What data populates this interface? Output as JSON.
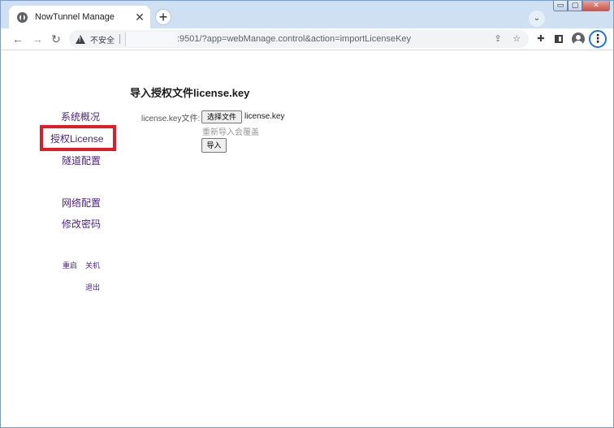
{
  "browser": {
    "tab_title": "NowTunnel Manage",
    "tab_close": "✕",
    "new_tab": "+",
    "tab_search": "⌄",
    "window_controls": {
      "minimize": "▭",
      "maximize": "▢",
      "close": "✕"
    },
    "back": "←",
    "forward": "→",
    "reload": "↻",
    "insecure_label": "不安全",
    "url_visible": ":9501/?app=webManage.control&action=importLicenseKey",
    "share_icon": "⇪",
    "bookmark_icon": "☆",
    "extensions_icon": "✚",
    "menu_icon": "⋮"
  },
  "sidebar": {
    "items": [
      {
        "label": "系统概况"
      },
      {
        "label": "授权License"
      },
      {
        "label": "隧道配置"
      },
      {
        "label": "网络配置"
      },
      {
        "label": "修改密码"
      }
    ],
    "actions": {
      "restart": "重启",
      "shutdown": "关机",
      "logout": "退出"
    },
    "highlight_color": "#e21c25"
  },
  "main": {
    "title": "导入授权文件license.key",
    "file_label": "license.key文件:",
    "choose_file": "选择文件",
    "file_name": "license.key",
    "hint": "重新导入会覆盖",
    "import_button": "导入"
  },
  "colors": {
    "link": "#4b1f8c",
    "tabstrip": "#cfe0f3"
  }
}
